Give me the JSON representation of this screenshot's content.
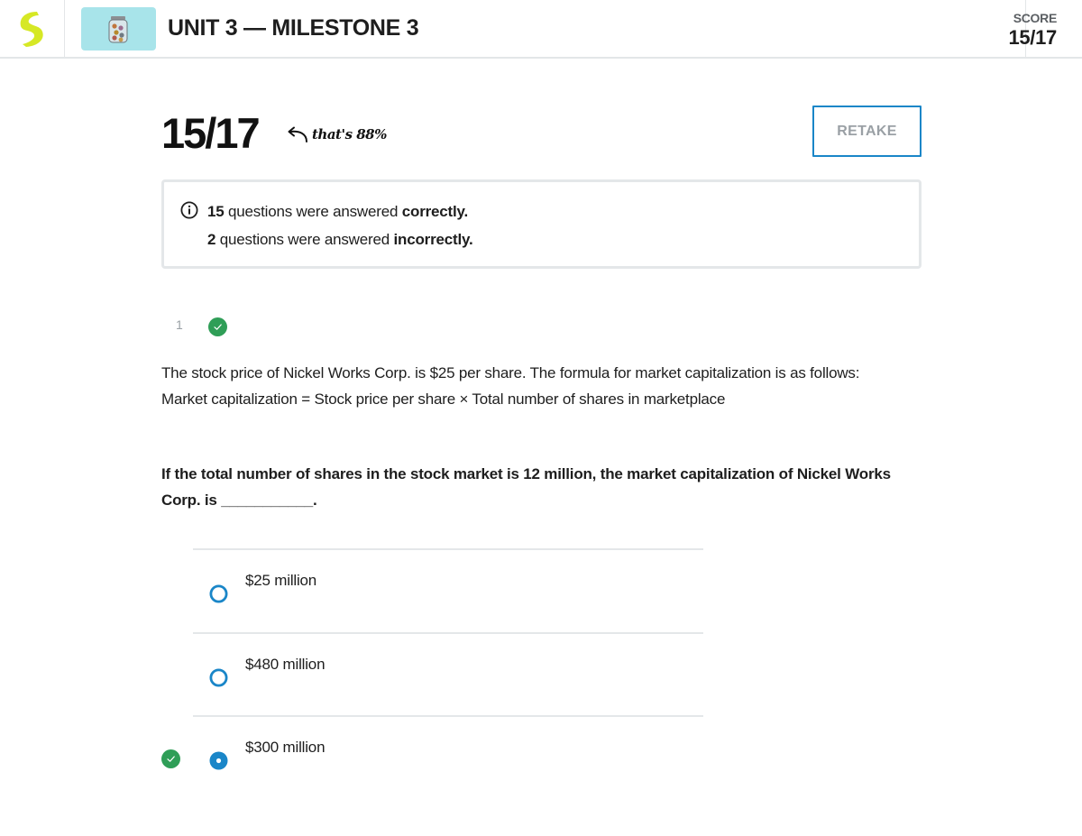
{
  "header": {
    "unit_title": "UNIT 3 — MILESTONE 3",
    "score_label": "SCORE",
    "score_value": "15/17",
    "logo_icon": "brand-logo-icon",
    "thumbnail_icon": "jar-of-coins-icon"
  },
  "result": {
    "score": "15/17",
    "note": "that's 88%",
    "note_icon": "curved-arrow-left-icon",
    "retake_label": "RETAKE"
  },
  "summary": {
    "icon": "info-icon",
    "correct_count": "15",
    "correct_text": "questions were answered",
    "correct_word": "correctly.",
    "incorrect_count": "2",
    "incorrect_text": "questions were answered",
    "incorrect_word": "incorrectly."
  },
  "question": {
    "number": "1",
    "status": "correct",
    "status_icon": "check-circle-icon",
    "text_line1": "The stock price of Nickel Works Corp. is $25 per share. The formula for market capitalization is as follows:",
    "text_line2": "Market capitalization = Stock price per share × Total number of shares in marketplace",
    "prompt": "If the total number of shares in the stock market is 12 million, the market capitalization of Nickel Works Corp. is ___________.",
    "options": [
      {
        "label": "$25 million",
        "selected": false,
        "correct": false
      },
      {
        "label": "$480 million",
        "selected": false,
        "correct": false
      },
      {
        "label": "$300 million",
        "selected": true,
        "correct": true
      }
    ]
  },
  "colors": {
    "accent_blue": "#1a86c8",
    "correct_green": "#2f9e57",
    "logo_yellow": "#d6e825",
    "thumb_bg": "#a8e4ea"
  }
}
